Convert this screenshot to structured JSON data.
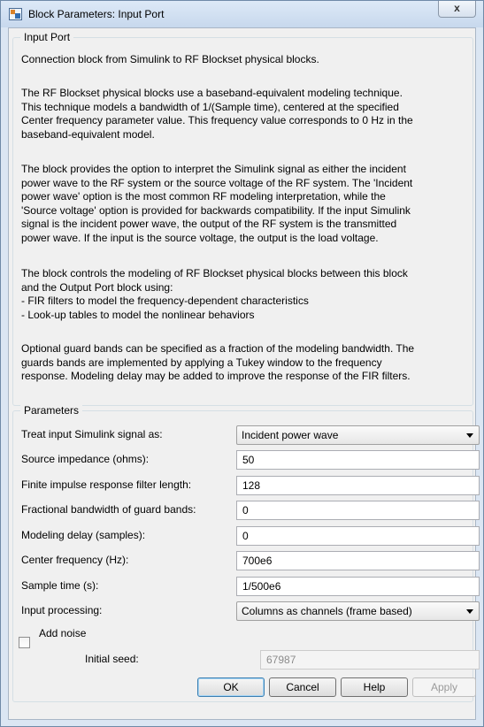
{
  "window": {
    "title": "Block Parameters: Input Port",
    "close_glyph": "x"
  },
  "description_group": {
    "legend": "Input Port",
    "paragraphs": [
      "Connection block from Simulink to RF Blockset physical blocks.",
      "The RF Blockset physical blocks use a baseband-equivalent modeling technique.\nThis technique models a bandwidth of 1/(Sample time), centered at the specified\nCenter frequency parameter value. This frequency value corresponds to 0 Hz in the\nbaseband-equivalent model.",
      "The block provides the option to interpret the Simulink signal as either the incident\npower wave to the RF system or the source voltage of the RF system. The 'Incident\npower wave' option is the most common RF modeling interpretation, while the\n'Source voltage' option is provided for backwards compatibility. If the input Simulink\nsignal is the incident power wave, the output of the RF system is the transmitted\npower wave. If the input is the source voltage, the output is the load voltage.",
      "The block controls the modeling of RF Blockset physical blocks between this block\nand the Output Port block using:\n  - FIR filters to model the frequency-dependent characteristics\n  - Look-up tables to model the nonlinear behaviors",
      "Optional guard bands can be specified as a fraction of the modeling bandwidth. The\nguards bands are implemented by applying a Tukey window to the frequency\nresponse. Modeling delay may be added to improve the response of the FIR filters."
    ]
  },
  "parameters": {
    "legend": "Parameters",
    "treat_input_label": "Treat input Simulink signal as:",
    "treat_input_value": "Incident power wave",
    "source_impedance_label": "Source impedance (ohms):",
    "source_impedance_value": "50",
    "fir_length_label": "Finite impulse response filter length:",
    "fir_length_value": "128",
    "guard_bandwidth_label": "Fractional bandwidth of guard bands:",
    "guard_bandwidth_value": "0",
    "modeling_delay_label": "Modeling delay (samples):",
    "modeling_delay_value": "0",
    "center_freq_label": "Center frequency (Hz):",
    "center_freq_value": "700e6",
    "sample_time_label": "Sample time (s):",
    "sample_time_value": "1/500e6",
    "input_processing_label": "Input processing:",
    "input_processing_value": "Columns as channels (frame based)",
    "add_noise_label": "Add noise",
    "add_noise_checked": false,
    "initial_seed_label": "Initial seed:",
    "initial_seed_value": "67987"
  },
  "buttons": {
    "ok": "OK",
    "cancel": "Cancel",
    "help": "Help",
    "apply": "Apply"
  }
}
